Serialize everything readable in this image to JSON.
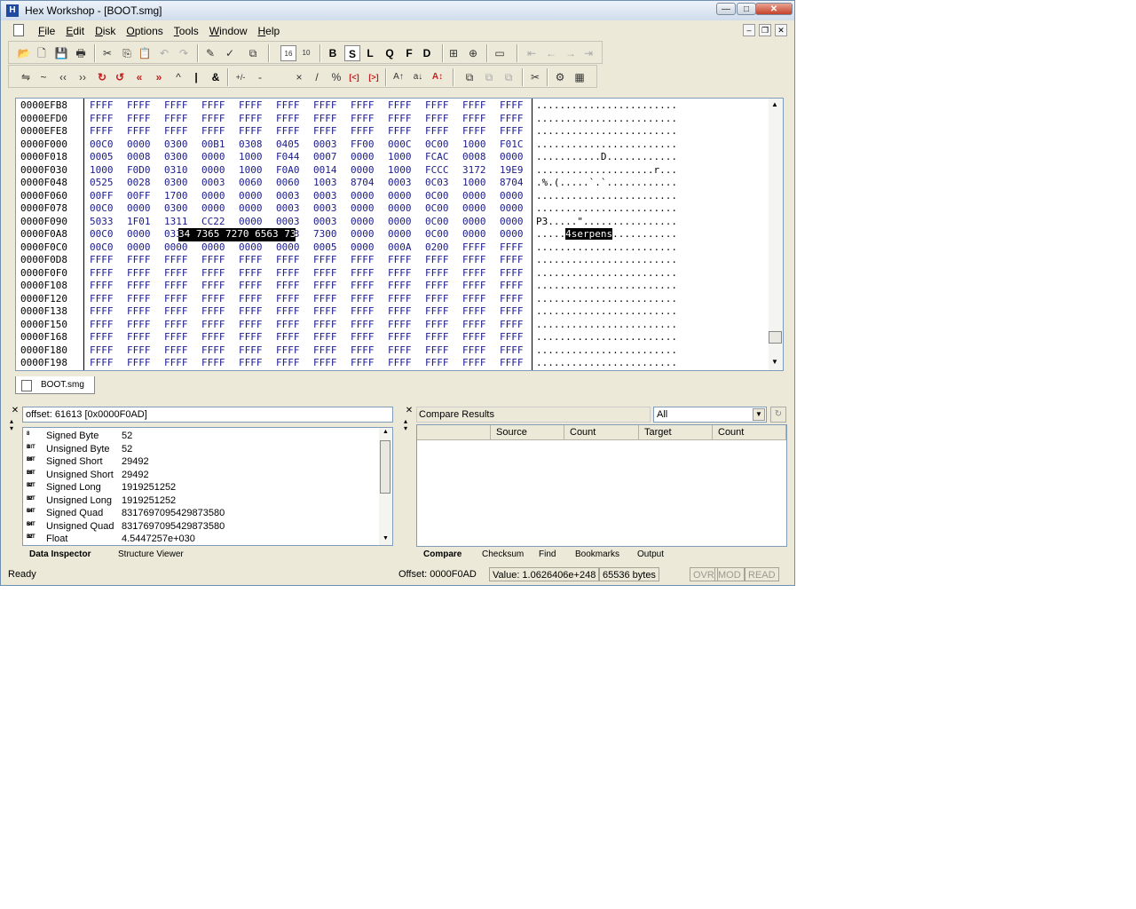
{
  "window": {
    "title": "Hex Workshop - [BOOT.smg]",
    "minimize": "—",
    "maximize": "□",
    "close": "✕"
  },
  "menu": [
    "File",
    "Edit",
    "Disk",
    "Options",
    "Tools",
    "Window",
    "Help"
  ],
  "mdi_controls": [
    "–",
    "❐",
    "✕"
  ],
  "toolbar1": {
    "groups": [
      [
        "open-icon",
        "new-icon",
        "save-icon",
        "print-icon"
      ],
      [
        "cut-icon",
        "copy-icon",
        "paste-icon",
        "undo-icon",
        "redo-icon"
      ],
      [
        "goto-icon",
        "mark-icon",
        "copy-clip-icon"
      ],
      [
        "hex-mode-icon",
        "dec-mode-icon"
      ],
      [
        "B",
        "S",
        "L",
        "Q",
        "F",
        "D"
      ],
      [
        "insert-icon",
        "append-icon"
      ],
      [
        "view-icon"
      ],
      [
        "first-icon",
        "prev-icon",
        "next-icon",
        "last-icon"
      ]
    ]
  },
  "toolbar2": {
    "symbols": [
      "⇋",
      "~",
      "‹‹",
      "››",
      "↻",
      "↺",
      "«",
      "»",
      "^",
      "|",
      "&",
      "+/-",
      "-",
      "×",
      "/",
      "%",
      "[<]",
      "[>]",
      "A↑",
      "a↓",
      "A↕"
    ]
  },
  "hex": {
    "rows": [
      {
        "offset": "0000EFB8",
        "words": [
          "FFFF",
          "FFFF",
          "FFFF",
          "FFFF",
          "FFFF",
          "FFFF",
          "FFFF",
          "FFFF",
          "FFFF",
          "FFFF",
          "FFFF",
          "FFFF"
        ],
        "ascii": "........................"
      },
      {
        "offset": "0000EFD0",
        "words": [
          "FFFF",
          "FFFF",
          "FFFF",
          "FFFF",
          "FFFF",
          "FFFF",
          "FFFF",
          "FFFF",
          "FFFF",
          "FFFF",
          "FFFF",
          "FFFF"
        ],
        "ascii": "........................"
      },
      {
        "offset": "0000EFE8",
        "words": [
          "FFFF",
          "FFFF",
          "FFFF",
          "FFFF",
          "FFFF",
          "FFFF",
          "FFFF",
          "FFFF",
          "FFFF",
          "FFFF",
          "FFFF",
          "FFFF"
        ],
        "ascii": "........................"
      },
      {
        "offset": "0000F000",
        "words": [
          "00C0",
          "0000",
          "0300",
          "00B1",
          "0308",
          "0405",
          "0003",
          "FF00",
          "000C",
          "0C00",
          "1000",
          "F01C"
        ],
        "ascii": "........................"
      },
      {
        "offset": "0000F018",
        "words": [
          "0005",
          "0008",
          "0300",
          "0000",
          "1000",
          "F044",
          "0007",
          "0000",
          "1000",
          "FCAC",
          "0008",
          "0000"
        ],
        "ascii": "...........D............"
      },
      {
        "offset": "0000F030",
        "words": [
          "1000",
          "F0D0",
          "0310",
          "0000",
          "1000",
          "F0A0",
          "0014",
          "0000",
          "1000",
          "FCCC",
          "3172",
          "19E9"
        ],
        "ascii": "....................r..."
      },
      {
        "offset": "0000F048",
        "words": [
          "0525",
          "0028",
          "0300",
          "0003",
          "0060",
          "0060",
          "1003",
          "8704",
          "0003",
          "0C03",
          "1000",
          "8704"
        ],
        "ascii": ".%.(.....`.`............"
      },
      {
        "offset": "0000F060",
        "words": [
          "00FF",
          "00FF",
          "1700",
          "0000",
          "0000",
          "0003",
          "0003",
          "0000",
          "0000",
          "0C00",
          "0000",
          "0000"
        ],
        "ascii": "........................"
      },
      {
        "offset": "0000F078",
        "words": [
          "00C0",
          "0000",
          "0300",
          "0000",
          "0000",
          "0003",
          "0003",
          "0000",
          "0000",
          "0C00",
          "0000",
          "0000"
        ],
        "ascii": "........................"
      },
      {
        "offset": "0000F090",
        "words": [
          "5033",
          "1F01",
          "1311",
          "CC22",
          "0000",
          "0003",
          "0003",
          "0000",
          "0000",
          "0C00",
          "0000",
          "0000"
        ],
        "ascii": "P3.....\"................"
      },
      {
        "offset": "0000F0A8",
        "words": [
          "00C0",
          "0000",
          "0334",
          "7365",
          "7270",
          "6563",
          "7300",
          "0000",
          "0000",
          "0C00",
          "0000",
          "0000"
        ],
        "ascii": ".....4serpens..........."
      },
      {
        "offset": "0000F0C0",
        "words": [
          "00C0",
          "0000",
          "0000",
          "0000",
          "0000",
          "0000",
          "0005",
          "0000",
          "000A",
          "0200",
          "FFFF",
          "FFFF"
        ],
        "ascii": "........................"
      },
      {
        "offset": "0000F0D8",
        "words": [
          "FFFF",
          "FFFF",
          "FFFF",
          "FFFF",
          "FFFF",
          "FFFF",
          "FFFF",
          "FFFF",
          "FFFF",
          "FFFF",
          "FFFF",
          "FFFF"
        ],
        "ascii": "........................"
      },
      {
        "offset": "0000F0F0",
        "words": [
          "FFFF",
          "FFFF",
          "FFFF",
          "FFFF",
          "FFFF",
          "FFFF",
          "FFFF",
          "FFFF",
          "FFFF",
          "FFFF",
          "FFFF",
          "FFFF"
        ],
        "ascii": "........................"
      },
      {
        "offset": "0000F108",
        "words": [
          "FFFF",
          "FFFF",
          "FFFF",
          "FFFF",
          "FFFF",
          "FFFF",
          "FFFF",
          "FFFF",
          "FFFF",
          "FFFF",
          "FFFF",
          "FFFF"
        ],
        "ascii": "........................"
      },
      {
        "offset": "0000F120",
        "words": [
          "FFFF",
          "FFFF",
          "FFFF",
          "FFFF",
          "FFFF",
          "FFFF",
          "FFFF",
          "FFFF",
          "FFFF",
          "FFFF",
          "FFFF",
          "FFFF"
        ],
        "ascii": "........................"
      },
      {
        "offset": "0000F138",
        "words": [
          "FFFF",
          "FFFF",
          "FFFF",
          "FFFF",
          "FFFF",
          "FFFF",
          "FFFF",
          "FFFF",
          "FFFF",
          "FFFF",
          "FFFF",
          "FFFF"
        ],
        "ascii": "........................"
      },
      {
        "offset": "0000F150",
        "words": [
          "FFFF",
          "FFFF",
          "FFFF",
          "FFFF",
          "FFFF",
          "FFFF",
          "FFFF",
          "FFFF",
          "FFFF",
          "FFFF",
          "FFFF",
          "FFFF"
        ],
        "ascii": "........................"
      },
      {
        "offset": "0000F168",
        "words": [
          "FFFF",
          "FFFF",
          "FFFF",
          "FFFF",
          "FFFF",
          "FFFF",
          "FFFF",
          "FFFF",
          "FFFF",
          "FFFF",
          "FFFF",
          "FFFF"
        ],
        "ascii": "........................"
      },
      {
        "offset": "0000F180",
        "words": [
          "FFFF",
          "FFFF",
          "FFFF",
          "FFFF",
          "FFFF",
          "FFFF",
          "FFFF",
          "FFFF",
          "FFFF",
          "FFFF",
          "FFFF",
          "FFFF"
        ],
        "ascii": "........................"
      },
      {
        "offset": "0000F198",
        "words": [
          "FFFF",
          "FFFF",
          "FFFF",
          "FFFF",
          "FFFF",
          "FFFF",
          "FFFF",
          "FFFF",
          "FFFF",
          "FFFF",
          "FFFF",
          "FFFF"
        ],
        "ascii": "........................"
      }
    ],
    "selection": {
      "row": 10,
      "hex_text": "34 7365 7270 6563 73",
      "ascii_text": "4serpens"
    },
    "scroll_up": "▲",
    "scroll_down": "▼"
  },
  "doc_tab": {
    "label": "BOOT.smg"
  },
  "inspector": {
    "offset_text": "offset: 61613 [0x0000F0AD]",
    "rows": [
      {
        "bits": "8 BIT",
        "label": "Signed Byte",
        "value": "52"
      },
      {
        "bits": "8 BIT",
        "label": "Unsigned Byte",
        "value": "52"
      },
      {
        "bits": "16 BIT",
        "label": "Signed Short",
        "value": "29492"
      },
      {
        "bits": "16 BIT",
        "label": "Unsigned Short",
        "value": "29492"
      },
      {
        "bits": "32 BIT",
        "label": "Signed Long",
        "value": "1919251252"
      },
      {
        "bits": "32 BIT",
        "label": "Unsigned Long",
        "value": "1919251252"
      },
      {
        "bits": "64 BIT",
        "label": "Signed Quad",
        "value": "8317697095429873580"
      },
      {
        "bits": "64 BIT",
        "label": "Unsigned Quad",
        "value": "8317697095429873580"
      },
      {
        "bits": "32 BIT",
        "label": "Float",
        "value": "4.5447257e+030"
      }
    ],
    "tabs": [
      "Data Inspector",
      "Structure Viewer"
    ]
  },
  "compare": {
    "title": "Compare Results",
    "filter_selected": "All",
    "refresh": "↻",
    "columns": [
      "",
      "Source",
      "Count",
      "Target",
      "Count"
    ],
    "tabs": [
      "Compare",
      "Checksum",
      "Find",
      "Bookmarks",
      "Output"
    ]
  },
  "status": {
    "left": "Ready",
    "offset": "Offset: 0000F0AD",
    "value": "Value: 1.0626406e+248",
    "size": "65536 bytes",
    "ovr": "OVR",
    "mod": "MOD",
    "read": "READ"
  }
}
